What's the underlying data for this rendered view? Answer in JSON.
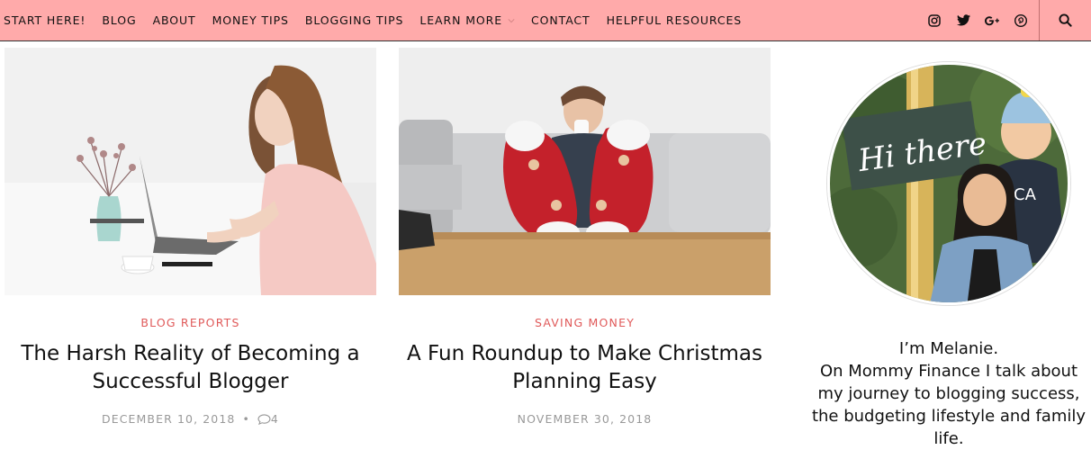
{
  "nav": {
    "items": [
      {
        "label": "START HERE!"
      },
      {
        "label": "BLOG"
      },
      {
        "label": "ABOUT"
      },
      {
        "label": "MONEY TIPS"
      },
      {
        "label": "BLOGGING TIPS"
      },
      {
        "label": "LEARN MORE"
      },
      {
        "label": "CONTACT"
      },
      {
        "label": "HELPFUL RESOURCES"
      }
    ],
    "social_icons": [
      "instagram-icon",
      "twitter-icon",
      "google-plus-icon",
      "pinterest-icon"
    ],
    "search_icon": "search-icon",
    "bg_color": "#ffaaaa"
  },
  "posts": [
    {
      "category": "BLOG REPORTS",
      "title": "The Harsh Reality of Becoming a Successful Blogger",
      "date": "DECEMBER 10, 2018",
      "separator": "•",
      "comments": "4"
    },
    {
      "category": "SAVING MONEY",
      "title": "A Fun Roundup to Make Christmas Planning Easy",
      "date": "NOVEMBER 30, 2018"
    }
  ],
  "sidebar": {
    "avatar_sign_text": "Hi there",
    "bio_line1": "I’m Melanie.",
    "bio_line2": "On Mommy Finance I talk about my journey to blogging success, the budgeting lifestyle and family life."
  },
  "colors": {
    "accent": "#e05a5a",
    "meta": "#999999"
  }
}
